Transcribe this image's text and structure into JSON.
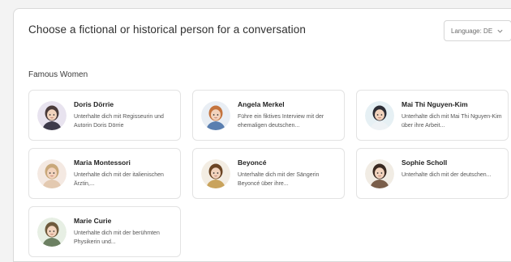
{
  "header": {
    "title": "Choose a fictional or historical person for a conversation",
    "language_label": "Language: DE"
  },
  "section": {
    "title": "Famous Women"
  },
  "people": [
    {
      "name": "Doris Dörrie",
      "description": "Unterhalte dich mit Regisseurin und Autorin Doris Dörrie",
      "avatar_icon": "woman-glasses-avatar-icon",
      "bg": "#e8e3ef",
      "hair": "#4a3b3a",
      "top": "#3d3a4a"
    },
    {
      "name": "Angela Merkel",
      "description": "Führe ein fiktives Interview mit der ehemaligen deutschen...",
      "avatar_icon": "woman-blonde-avatar-icon",
      "bg": "#e9eef4",
      "hair": "#c4743e",
      "top": "#5a7fb0"
    },
    {
      "name": "Mai Thi Nguyen-Kim",
      "description": "Unterhalte dich mit Mai Thi Nguyen-Kim über ihre Arbeit...",
      "avatar_icon": "scientist-avatar-icon",
      "bg": "#e6f0f4",
      "hair": "#2d2d35",
      "top": "#eef2f5"
    },
    {
      "name": "Maria Montessori",
      "description": "Unterhalte dich mit der italienischen Ärztin,...",
      "avatar_icon": "teacher-avatar-icon",
      "bg": "#f4e9e2",
      "hair": "#c9a87a",
      "top": "#e3c9b0"
    },
    {
      "name": "Beyoncé",
      "description": "Unterhalte dich mit der Sängerin Beyoncé über ihre...",
      "avatar_icon": "singer-avatar-icon",
      "bg": "#f3ede3",
      "hair": "#6b4423",
      "top": "#c9a35c"
    },
    {
      "name": "Sophie Scholl",
      "description": "Unterhalte dich mit der deutschen...",
      "avatar_icon": "woman-dark-hair-avatar-icon",
      "bg": "#f1ece4",
      "hair": "#3a2a22",
      "top": "#7a5e4a"
    },
    {
      "name": "Marie Curie",
      "description": "Unterhalte dich mit der berühmten Physikerin und...",
      "avatar_icon": "physicist-avatar-icon",
      "bg": "#e7efe4",
      "hair": "#6e5a3c",
      "top": "#6c8062"
    }
  ]
}
